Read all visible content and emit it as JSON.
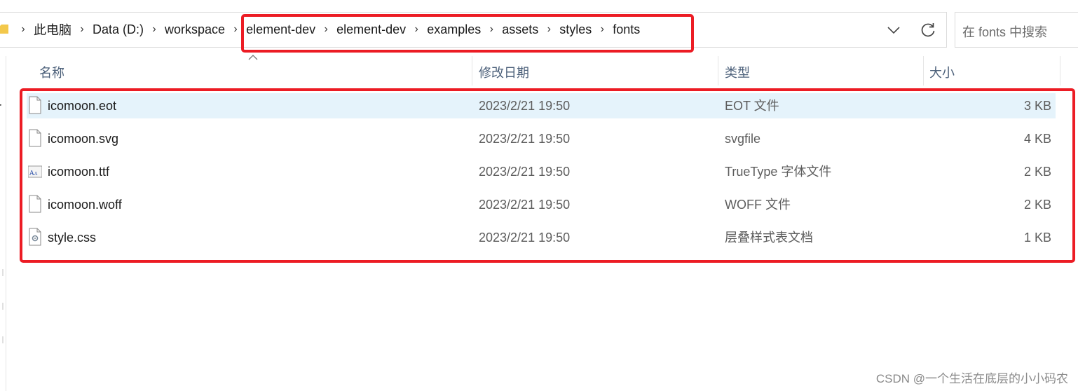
{
  "address_bar": {
    "breadcrumbs": [
      "此电脑",
      "Data (D:)",
      "workspace",
      "element-dev",
      "element-dev",
      "examples",
      "assets",
      "styles",
      "fonts"
    ]
  },
  "search": {
    "placeholder": "在 fonts 中搜索"
  },
  "nav": {
    "partial_label": "r"
  },
  "columns": {
    "name": "名称",
    "date": "修改日期",
    "type": "类型",
    "size": "大小"
  },
  "files": [
    {
      "name": "icomoon.eot",
      "date": "2023/2/21 19:50",
      "type": "EOT 文件",
      "size": "3 KB",
      "icon": "blank-file-icon",
      "selected": true
    },
    {
      "name": "icomoon.svg",
      "date": "2023/2/21 19:50",
      "type": "svgfile",
      "size": "4 KB",
      "icon": "blank-file-icon",
      "selected": false
    },
    {
      "name": "icomoon.ttf",
      "date": "2023/2/21 19:50",
      "type": "TrueType 字体文件",
      "size": "2 KB",
      "icon": "font-file-icon",
      "selected": false
    },
    {
      "name": "icomoon.woff",
      "date": "2023/2/21 19:50",
      "type": "WOFF 文件",
      "size": "2 KB",
      "icon": "blank-file-icon",
      "selected": false
    },
    {
      "name": "style.css",
      "date": "2023/2/21 19:50",
      "type": "层叠样式表文档",
      "size": "1 KB",
      "icon": "css-file-icon",
      "selected": false
    }
  ],
  "watermark": "CSDN @一个生活在底层的小小码农",
  "colors": {
    "highlight": "#ec1c24",
    "selected_row": "#e5f3fb",
    "header_text": "#4c607a"
  }
}
